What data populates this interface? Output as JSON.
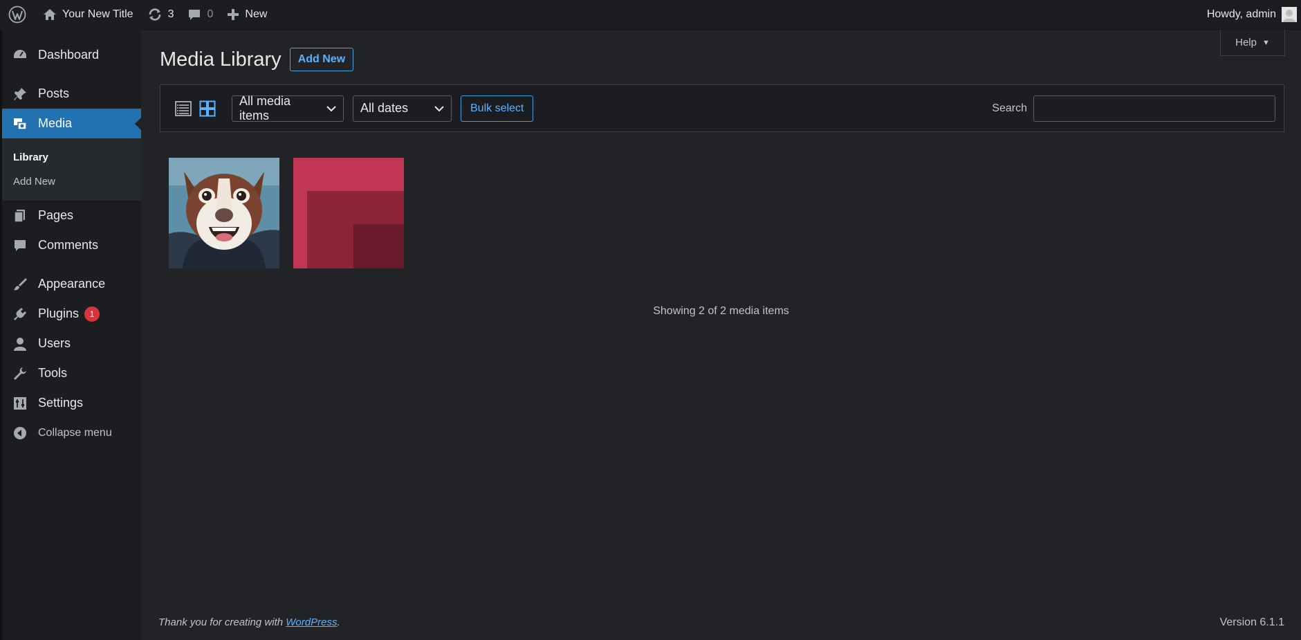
{
  "adminbar": {
    "site_title": "Your New Title",
    "updates_count": "3",
    "comments_count": "0",
    "new_label": "New",
    "howdy": "Howdy, admin"
  },
  "sidebar": {
    "items": [
      {
        "label": "Dashboard",
        "icon": "dashboard-icon"
      },
      {
        "label": "Posts",
        "icon": "pushpin-icon"
      },
      {
        "label": "Media",
        "icon": "media-icon"
      },
      {
        "label": "Pages",
        "icon": "pages-icon"
      },
      {
        "label": "Comments",
        "icon": "comment-icon"
      },
      {
        "label": "Appearance",
        "icon": "paintbrush-icon"
      },
      {
        "label": "Plugins",
        "icon": "plugin-icon"
      },
      {
        "label": "Users",
        "icon": "user-icon"
      },
      {
        "label": "Tools",
        "icon": "wrench-icon"
      },
      {
        "label": "Settings",
        "icon": "settings-icon"
      }
    ],
    "submenu": [
      "Library",
      "Add New"
    ],
    "plugins_badge": "1",
    "collapse_label": "Collapse menu"
  },
  "main": {
    "help_label": "Help",
    "page_title": "Media Library",
    "add_new_label": "Add New",
    "filter_type": "All media items",
    "filter_date": "All dates",
    "bulk_select_label": "Bulk select",
    "search_label": "Search",
    "search_value": "",
    "attachments": [
      {
        "name": "dog-photo",
        "kind": "image"
      },
      {
        "name": "red-abstract",
        "kind": "image"
      }
    ],
    "showing_text": "Showing 2 of 2 media items"
  },
  "footer": {
    "thanks_prefix": "Thank you for creating with ",
    "thanks_link": "WordPress",
    "thanks_suffix": ".",
    "version": "Version 6.1.1"
  },
  "colors": {
    "accent": "#2271b1",
    "link": "#5ab2ff",
    "badge": "#d63638",
    "background": "#222326",
    "sidebar": "#1b1d20"
  }
}
